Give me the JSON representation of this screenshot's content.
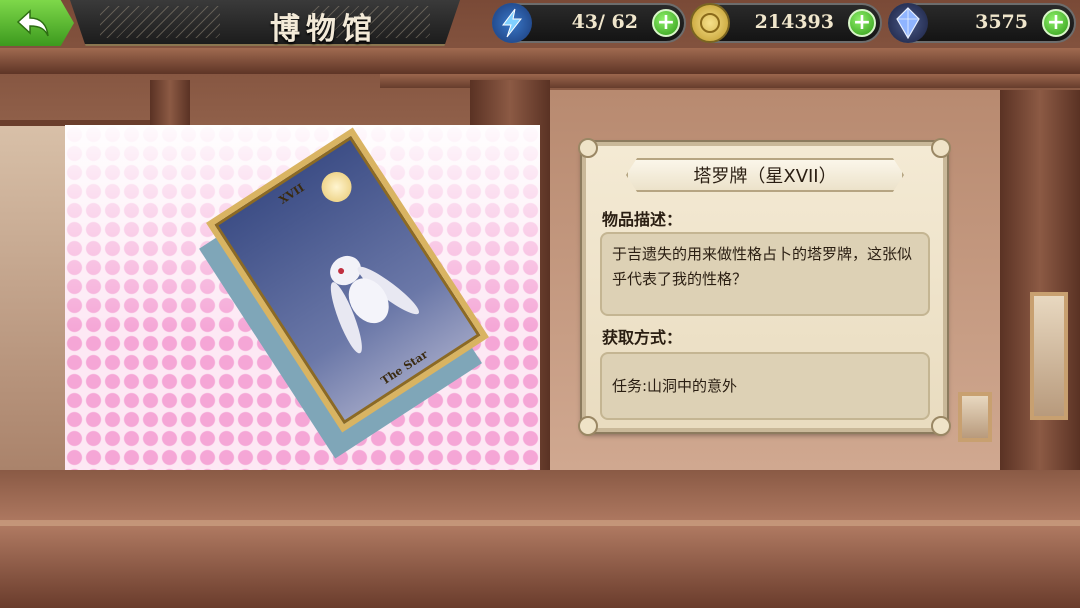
{
  "header": {
    "title": "博物馆",
    "back_icon": "back-arrow-icon"
  },
  "resources": {
    "stamina": {
      "icon": "lightning-icon",
      "value": "43/ 62"
    },
    "gold": {
      "icon": "coin-icon",
      "value": "214393"
    },
    "gems": {
      "icon": "crystal-icon",
      "value": "3575"
    }
  },
  "card_image": {
    "numeral": "XVII",
    "card_name": "The Star"
  },
  "info": {
    "item_name": "塔罗牌（星XVII）",
    "description_label": "物品描述：",
    "description": "于吉遗失的用来做性格占卜的塔罗牌，这张似乎代表了我的性格？",
    "acquire_label": "获取方式：",
    "acquire": "任务:山洞中的意外"
  },
  "colors": {
    "back_button": "#4fb82a",
    "plus_button": "#3fae20",
    "panel_bg": "#f1e6cc",
    "dots": "#f5a6d6"
  }
}
